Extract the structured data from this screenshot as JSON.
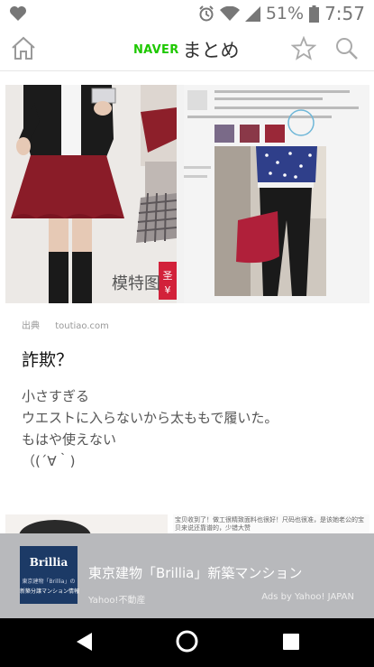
{
  "status_bar": {
    "battery_percent": "51%",
    "time": "7:57",
    "icons": [
      "heart-icon",
      "alarm-icon",
      "wifi-icon",
      "signal-icon",
      "battery-icon"
    ]
  },
  "app_bar": {
    "brand": "NAVER",
    "title": "まとめ",
    "icons": [
      "home-icon",
      "star-icon",
      "search-icon"
    ]
  },
  "article": {
    "image_caption_left": "模特图",
    "source_label": "出典",
    "source": "toutiao.com",
    "title": "詐欺？",
    "body_lines": [
      "小さすぎる",
      "ウエストに入らないから太ももで履いた。",
      "もはや使えない",
      "（(´∀｀)"
    ]
  },
  "next_item": {
    "snippet": "宝贝收到了！做工很精致面料也很好！尺码也很准，是该她老公的宝贝来说还靠谱的，少错大赞"
  },
  "ad": {
    "logo_text": "Brillia",
    "logo_sub1": "東京建物「Brillia」の",
    "logo_sub2": "新築分譲マンション情報",
    "headline": "東京建物「Brillia」新築マンション",
    "advertiser": "Yahoo!不動産",
    "credit": "Ads by Yahoo! JAPAN"
  },
  "colors": {
    "naver_green": "#1ec800",
    "ad_background": "#b8b9bc",
    "nav_background": "#000000"
  },
  "nav_bar": {
    "icons": [
      "back-icon",
      "home-circle-icon",
      "recents-icon"
    ]
  }
}
